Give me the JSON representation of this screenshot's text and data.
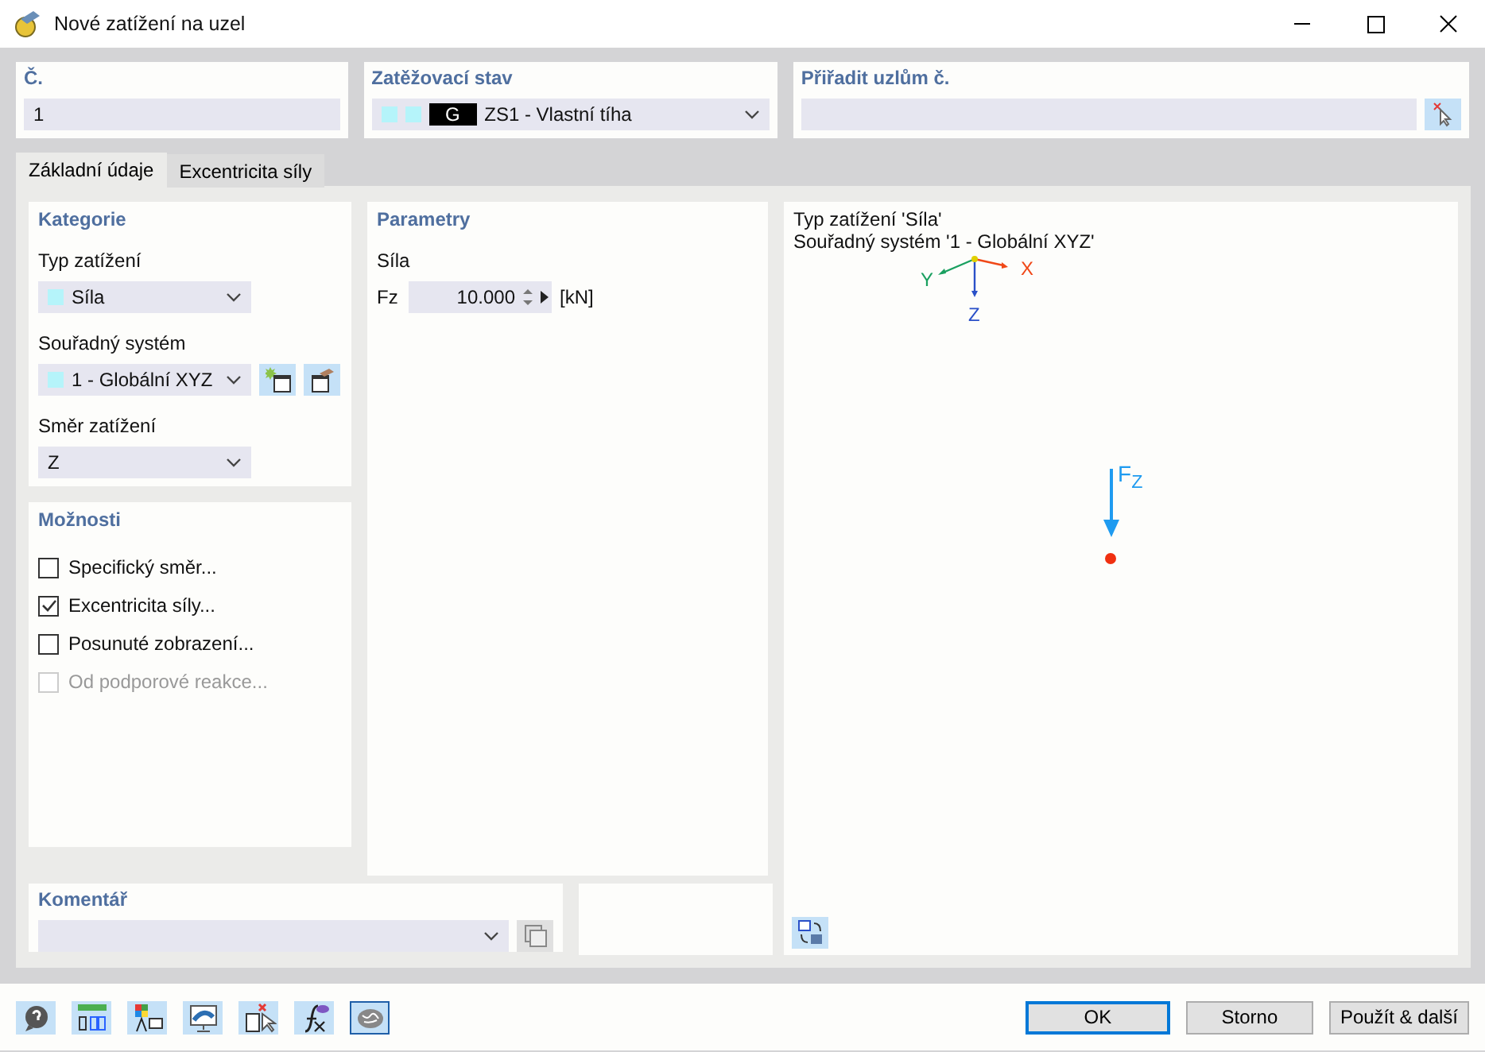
{
  "window": {
    "title": "Nové zatížení na uzel"
  },
  "number": {
    "label": "Č.",
    "value": "1"
  },
  "load_case": {
    "label": "Zatěžovací stav",
    "badge": "G",
    "value": "ZS1 - Vlastní tíha"
  },
  "assign_nodes": {
    "label": "Přiřadit uzlům č."
  },
  "tabs": [
    {
      "label": "Základní údaje",
      "selected": true
    },
    {
      "label": "Excentricita síly",
      "selected": false
    }
  ],
  "category": {
    "title": "Kategorie",
    "fields": [
      {
        "label": "Typ zatížení",
        "value": "Síla",
        "swatch": true,
        "buttons": false
      },
      {
        "label": "Souřadný systém",
        "value": "1 - Globální XYZ",
        "swatch": true,
        "buttons": true
      },
      {
        "label": "Směr zatížení",
        "value": "Z",
        "swatch": false,
        "buttons": false
      }
    ]
  },
  "options": {
    "title": "Možnosti",
    "items": [
      {
        "label": "Specifický směr...",
        "checked": false,
        "disabled": false
      },
      {
        "label": "Excentricita síly...",
        "checked": true,
        "disabled": false
      },
      {
        "label": "Posunuté zobrazení...",
        "checked": false,
        "disabled": false
      },
      {
        "label": "Od podporové reakce...",
        "checked": false,
        "disabled": true
      }
    ]
  },
  "parameters": {
    "title": "Parametry",
    "group": "Síla",
    "symbol": "Fz",
    "value": "10.000",
    "unit": "[kN]"
  },
  "preview": {
    "lines": [
      "Typ zatížení 'Síla'",
      "Souřadný systém '1 - Globální XYZ'"
    ],
    "axes": {
      "x": "X",
      "y": "Y",
      "z": "Z"
    },
    "force_label": "F$_{Z}$"
  },
  "comment": {
    "label": "Komentář"
  },
  "toolbar": [
    {
      "kind": "help",
      "selected": false
    },
    {
      "kind": "units",
      "selected": false
    },
    {
      "kind": "colors",
      "selected": false
    },
    {
      "kind": "display",
      "selected": false
    },
    {
      "kind": "select",
      "selected": false
    },
    {
      "kind": "formula",
      "selected": false
    },
    {
      "kind": "brain",
      "selected": true
    }
  ],
  "buttons": [
    {
      "label": "OK",
      "default": true
    },
    {
      "label": "Storno",
      "default": false
    },
    {
      "label": "Použít & další",
      "default": false
    }
  ]
}
